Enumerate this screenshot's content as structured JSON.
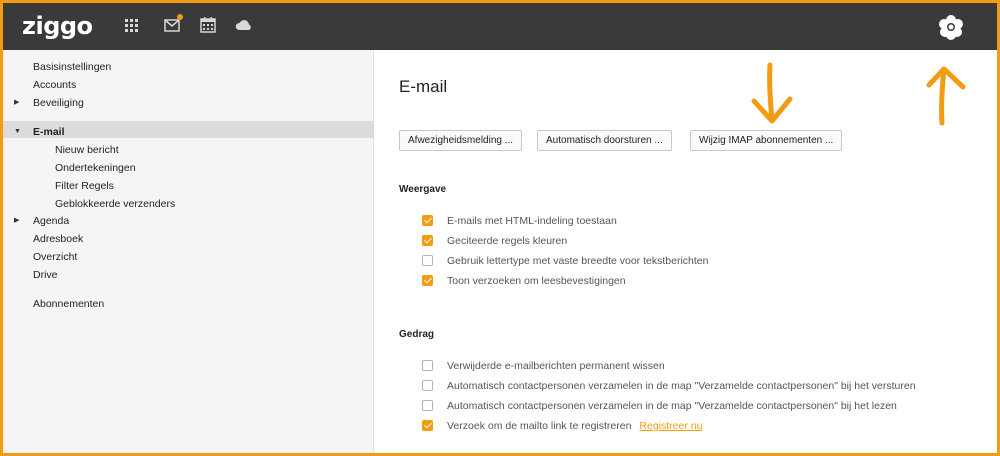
{
  "header": {
    "logo": "ziggo",
    "icons": [
      "apps-grid-icon",
      "mail-icon",
      "calendar-icon",
      "cloud-icon",
      "avatar-icon"
    ],
    "accent_color": "#f39c12"
  },
  "sidebar": {
    "items": [
      {
        "label": "Basisinstellingen"
      },
      {
        "label": "Accounts"
      },
      {
        "label": "Beveiliging"
      },
      {
        "label": "E-mail"
      },
      {
        "label": "Nieuw bericht"
      },
      {
        "label": "Ondertekeningen"
      },
      {
        "label": "Filter Regels"
      },
      {
        "label": "Geblokkeerde verzenders"
      },
      {
        "label": "Agenda"
      },
      {
        "label": "Adresboek"
      },
      {
        "label": "Overzicht"
      },
      {
        "label": "Drive"
      },
      {
        "label": "Abonnementen"
      }
    ]
  },
  "main": {
    "title": "E-mail",
    "buttons": [
      "Afwezigheidsmelding ...",
      "Automatisch doorsturen ...",
      "Wijzig IMAP abonnementen ..."
    ],
    "sections": [
      {
        "title": "Weergave",
        "options": [
          {
            "label": "E-mails met HTML-indeling toestaan",
            "checked": true
          },
          {
            "label": "Geciteerde regels kleuren",
            "checked": true
          },
          {
            "label": "Gebruik lettertype met vaste breedte voor tekstberichten",
            "checked": false
          },
          {
            "label": "Toon verzoeken om leesbevestigingen",
            "checked": true
          }
        ]
      },
      {
        "title": "Gedrag",
        "options": [
          {
            "label": "Verwijderde e-mailberichten permanent wissen",
            "checked": false
          },
          {
            "label": "Automatisch contactpersonen verzamelen in de map \"Verzamelde contactpersonen\" bij het versturen",
            "checked": false
          },
          {
            "label": "Automatisch contactpersonen verzamelen in de map \"Verzamelde contactpersonen\" bij het lezen",
            "checked": false
          },
          {
            "label": "Verzoek om de mailto link te registreren",
            "checked": true,
            "link": "Registreer nu"
          }
        ]
      }
    ]
  },
  "annotations": {
    "arrow_color": "#f39c12"
  }
}
